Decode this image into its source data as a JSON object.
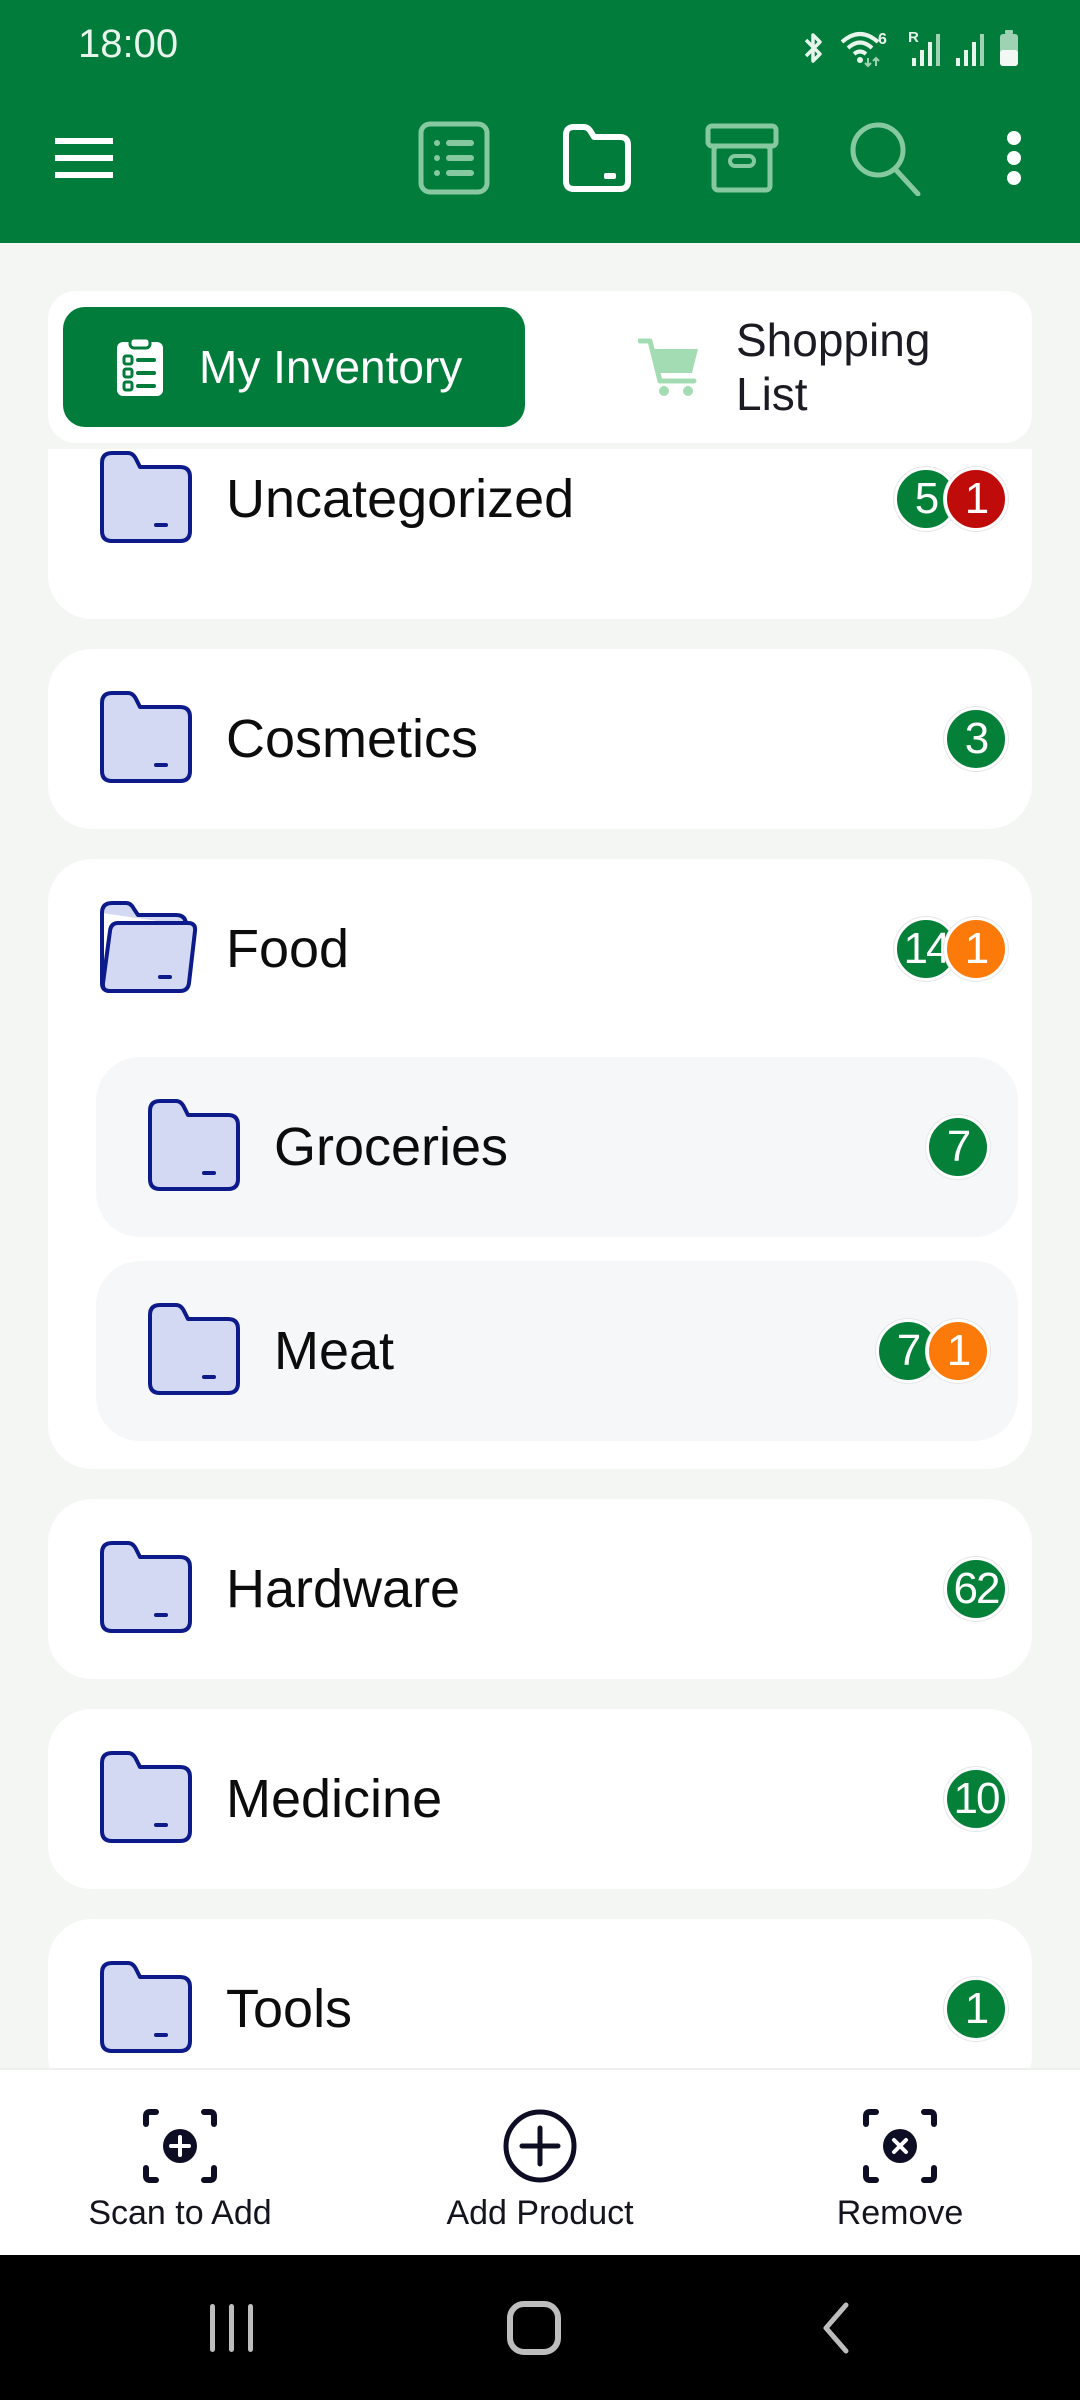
{
  "status_bar": {
    "time": "18:00",
    "icons": [
      "bluetooth-icon",
      "wifi-icon",
      "signal-r-icon",
      "signal-icon",
      "battery-icon"
    ]
  },
  "toolbar": {
    "menu_icon": "hamburger-menu-icon",
    "actions": [
      {
        "name": "list-view",
        "icon": "list-icon",
        "active": false
      },
      {
        "name": "folder-view",
        "icon": "folder-icon",
        "active": true
      },
      {
        "name": "archive",
        "icon": "archive-box-icon",
        "active": false
      },
      {
        "name": "search",
        "icon": "search-icon",
        "active": false
      },
      {
        "name": "more",
        "icon": "more-vertical-icon",
        "active": true
      }
    ]
  },
  "tabs": [
    {
      "label": "My Inventory",
      "icon": "clipboard-list-icon",
      "active": true
    },
    {
      "label": "Shopping List",
      "icon": "shopping-cart-icon",
      "active": false
    }
  ],
  "categories": [
    {
      "name": "Uncategorized",
      "badges": [
        {
          "value": "5",
          "color": "green"
        },
        {
          "value": "1",
          "color": "red"
        }
      ]
    },
    {
      "name": "Cosmetics",
      "badges": [
        {
          "value": "3",
          "color": "green"
        }
      ]
    },
    {
      "name": "Food",
      "expanded": true,
      "badges": [
        {
          "value": "14",
          "color": "green"
        },
        {
          "value": "1",
          "color": "orange"
        }
      ],
      "children": [
        {
          "name": "Groceries",
          "badges": [
            {
              "value": "7",
              "color": "green"
            }
          ]
        },
        {
          "name": "Meat",
          "badges": [
            {
              "value": "7",
              "color": "green"
            },
            {
              "value": "1",
              "color": "orange"
            }
          ]
        }
      ]
    },
    {
      "name": "Hardware",
      "badges": [
        {
          "value": "62",
          "color": "green"
        }
      ]
    },
    {
      "name": "Medicine",
      "badges": [
        {
          "value": "10",
          "color": "green"
        }
      ]
    },
    {
      "name": "Tools",
      "badges": [
        {
          "value": "1",
          "color": "green"
        }
      ]
    }
  ],
  "actions": [
    {
      "label": "Scan to Add",
      "icon": "scan-add-icon"
    },
    {
      "label": "Add Product",
      "icon": "add-circle-icon"
    },
    {
      "label": "Remove",
      "icon": "scan-remove-icon"
    }
  ],
  "nav_bar": [
    "recents-icon",
    "home-icon",
    "back-icon"
  ],
  "colors": {
    "primary": "#017c3b",
    "badge_green": "#058038",
    "badge_red": "#c00b0b",
    "badge_orange": "#fb7a0a",
    "folder_fill": "#d3d8f3",
    "folder_stroke": "#0d1a8a"
  }
}
